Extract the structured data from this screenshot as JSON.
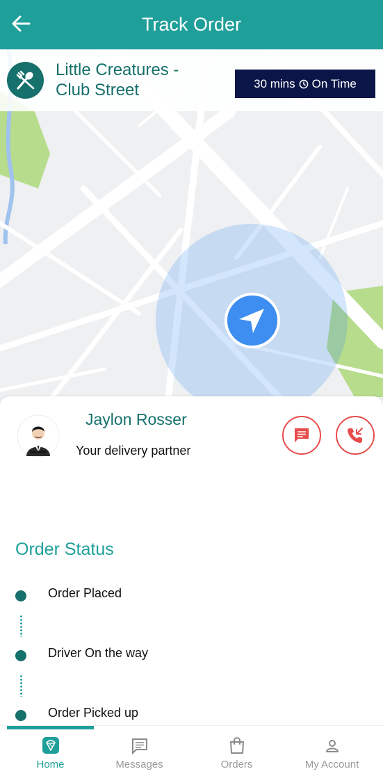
{
  "header": {
    "title": "Track Order"
  },
  "restaurant": {
    "name_line1": "Little Creatures -",
    "name_line2": "Club Street"
  },
  "eta": {
    "duration": "30 mins",
    "status": "On Time"
  },
  "driver": {
    "name": "Jaylon Rosser",
    "role": "Your delivery partner"
  },
  "order_status": {
    "title": "Order Status",
    "steps": [
      {
        "label": "Order Placed"
      },
      {
        "label": "Driver On the way"
      },
      {
        "label": "Order Picked up"
      }
    ]
  },
  "bottom_nav": [
    {
      "label": "Home",
      "icon": "home-icon",
      "active": true
    },
    {
      "label": "Messages",
      "icon": "messages-icon",
      "active": false
    },
    {
      "label": "Orders",
      "icon": "orders-bag-icon",
      "active": false
    },
    {
      "label": "My Account",
      "icon": "account-icon",
      "active": false
    }
  ],
  "colors": {
    "primary": "#1f9f9a",
    "primary_dark": "#16706b",
    "eta_bg": "#0b1547",
    "accent_red": "#e84c4c",
    "map_marker": "#3d8ef0"
  }
}
